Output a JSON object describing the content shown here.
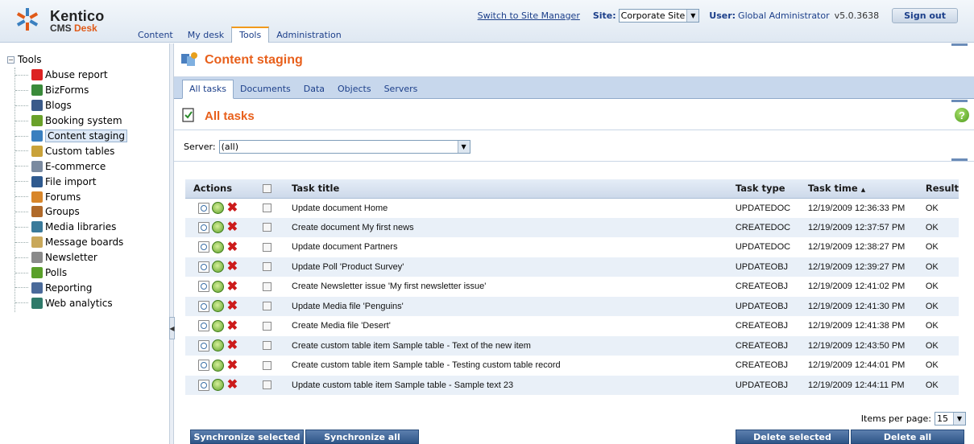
{
  "app": {
    "brand": "Kentico",
    "product_prefix": "CMS",
    "product_suffix": "Desk"
  },
  "top": {
    "switch_link": "Switch to Site Manager",
    "site_label": "Site:",
    "site_value": "Corporate Site",
    "user_label": "User:",
    "user_value": "Global Administrator",
    "version": "v5.0.3638",
    "signout": "Sign out"
  },
  "main_tabs": [
    {
      "label": "Content"
    },
    {
      "label": "My desk"
    },
    {
      "label": "Tools",
      "active": true
    },
    {
      "label": "Administration"
    }
  ],
  "tree": {
    "root": "Tools",
    "items": [
      {
        "label": "Abuse report",
        "icon": "abuse-report-icon",
        "color": "#d22"
      },
      {
        "label": "BizForms",
        "icon": "bizforms-icon",
        "color": "#3a8a3a"
      },
      {
        "label": "Blogs",
        "icon": "blogs-icon",
        "color": "#3b5b8a"
      },
      {
        "label": "Booking system",
        "icon": "booking-system-icon",
        "color": "#6aa12a"
      },
      {
        "label": "Content staging",
        "icon": "content-staging-icon",
        "color": "#3a7fbf",
        "selected": true
      },
      {
        "label": "Custom tables",
        "icon": "custom-tables-icon",
        "color": "#c9a23a"
      },
      {
        "label": "E-commerce",
        "icon": "e-commerce-icon",
        "color": "#7a8aa0"
      },
      {
        "label": "File import",
        "icon": "file-import-icon",
        "color": "#2f5a8f"
      },
      {
        "label": "Forums",
        "icon": "forums-icon",
        "color": "#d8862a"
      },
      {
        "label": "Groups",
        "icon": "groups-icon",
        "color": "#b06a2a"
      },
      {
        "label": "Media libraries",
        "icon": "media-libraries-icon",
        "color": "#3a7a9a"
      },
      {
        "label": "Message boards",
        "icon": "message-boards-icon",
        "color": "#c9a85a"
      },
      {
        "label": "Newsletter",
        "icon": "newsletter-icon",
        "color": "#8a8a8a"
      },
      {
        "label": "Polls",
        "icon": "polls-icon",
        "color": "#5aa02a"
      },
      {
        "label": "Reporting",
        "icon": "reporting-icon",
        "color": "#4a6a9a"
      },
      {
        "label": "Web analytics",
        "icon": "web-analytics-icon",
        "color": "#2f7a6a"
      }
    ]
  },
  "page": {
    "title": "Content staging",
    "sub_tabs": [
      {
        "label": "All tasks",
        "active": true
      },
      {
        "label": "Documents"
      },
      {
        "label": "Data"
      },
      {
        "label": "Objects"
      },
      {
        "label": "Servers"
      }
    ],
    "section_title": "All tasks",
    "server_label": "Server:",
    "server_value": "(all)"
  },
  "grid": {
    "headers": {
      "actions": "Actions",
      "title": "Task title",
      "type": "Task type",
      "time": "Task time",
      "time_sort": "▲",
      "result": "Result"
    },
    "rows": [
      {
        "title": "Update document Home",
        "type": "UPDATEDOC",
        "time": "12/19/2009 12:36:33 PM",
        "result": "OK"
      },
      {
        "title": "Create document My first news",
        "type": "CREATEDOC",
        "time": "12/19/2009 12:37:57 PM",
        "result": "OK"
      },
      {
        "title": "Update document Partners",
        "type": "UPDATEDOC",
        "time": "12/19/2009 12:38:27 PM",
        "result": "OK"
      },
      {
        "title": "Update Poll 'Product Survey'",
        "type": "UPDATEOBJ",
        "time": "12/19/2009 12:39:27 PM",
        "result": "OK"
      },
      {
        "title": "Create Newsletter issue 'My first newsletter issue'",
        "type": "CREATEOBJ",
        "time": "12/19/2009 12:41:02 PM",
        "result": "OK"
      },
      {
        "title": "Update Media file 'Penguins'",
        "type": "UPDATEOBJ",
        "time": "12/19/2009 12:41:30 PM",
        "result": "OK"
      },
      {
        "title": "Create Media file 'Desert'",
        "type": "CREATEOBJ",
        "time": "12/19/2009 12:41:38 PM",
        "result": "OK"
      },
      {
        "title": "Create custom table item Sample table - Text of the new item",
        "type": "CREATEOBJ",
        "time": "12/19/2009 12:43:50 PM",
        "result": "OK"
      },
      {
        "title": "Create custom table item Sample table - Testing custom table record",
        "type": "CREATEOBJ",
        "time": "12/19/2009 12:44:01 PM",
        "result": "OK"
      },
      {
        "title": "Update custom table item Sample table - Sample text 23",
        "type": "UPDATEOBJ",
        "time": "12/19/2009 12:44:11 PM",
        "result": "OK"
      }
    ]
  },
  "pager": {
    "label": "Items per page:",
    "value": "15"
  },
  "buttons": {
    "sync_selected": "Synchronize selected",
    "sync_all": "Synchronize all",
    "delete_selected": "Delete selected",
    "delete_all": "Delete all"
  },
  "colors": {
    "accent_orange": "#e8601c",
    "link_blue": "#1c3f8a",
    "button_blue": "#2f5688",
    "row_alt": "#e9f0f8"
  }
}
